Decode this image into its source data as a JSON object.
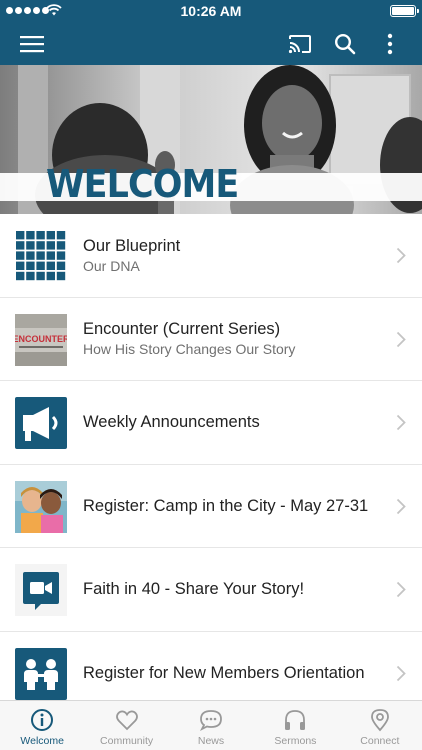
{
  "status_bar": {
    "time": "10:26 AM"
  },
  "nav_bar": {
    "icons": [
      "menu-icon",
      "cast-icon",
      "search-icon",
      "more-vertical-icon"
    ]
  },
  "hero": {
    "title": "WELCOME"
  },
  "list": {
    "items": [
      {
        "title": "Our Blueprint",
        "subtitle": "Our DNA",
        "icon": "grid-icon"
      },
      {
        "title": "Encounter (Current Series)",
        "subtitle": "How His Story Changes Our Story",
        "icon": "series-artwork",
        "artwork_text": "ENCOUNTER"
      },
      {
        "title": "Weekly Announcements",
        "subtitle": "",
        "icon": "megaphone-icon"
      },
      {
        "title": "Register: Camp in the City - May 27-31",
        "subtitle": "",
        "icon": "kids-photo"
      },
      {
        "title": "Faith in 40 - Share Your Story!",
        "subtitle": "",
        "icon": "video-camera-icon"
      },
      {
        "title": "Register for New Members Orientation",
        "subtitle": "",
        "icon": "people-icon"
      }
    ]
  },
  "tab_bar": {
    "active": "Welcome",
    "tabs": [
      {
        "label": "Welcome",
        "icon": "info-icon"
      },
      {
        "label": "Community",
        "icon": "heart-icon"
      },
      {
        "label": "News",
        "icon": "chat-bubble-icon"
      },
      {
        "label": "Sermons",
        "icon": "headphones-icon"
      },
      {
        "label": "Connect",
        "icon": "location-pin-icon"
      }
    ]
  },
  "colors": {
    "brand": "#17597a",
    "active_tab": "#17597a",
    "inactive_tab": "#999999"
  }
}
